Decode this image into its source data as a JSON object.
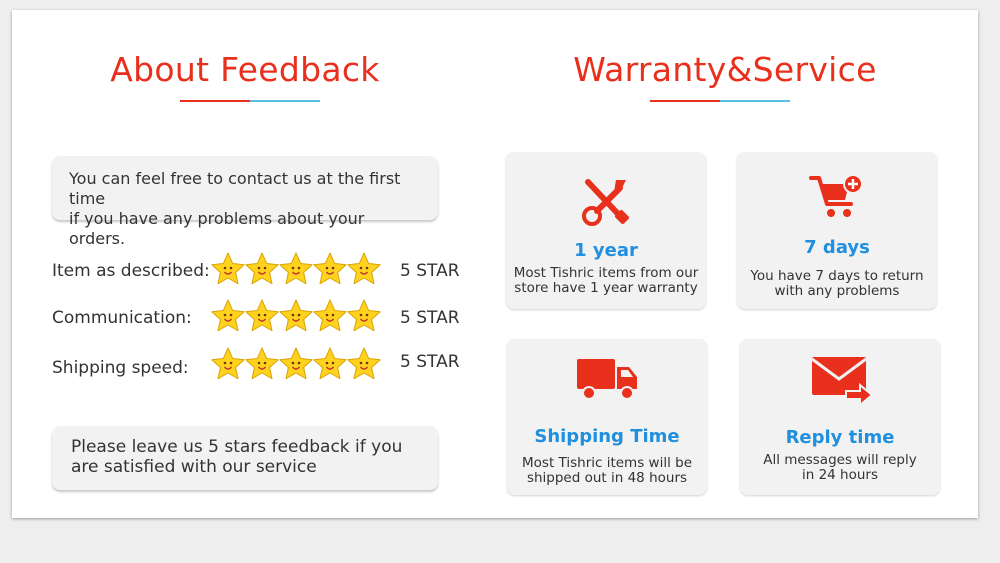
{
  "feedback": {
    "title": "About Feedback",
    "note_top": [
      "You can feel free to contact us at the first time",
      "if you have any problems about your orders."
    ],
    "ratings": [
      {
        "label": "Item as described:",
        "value": "5 STAR",
        "stars": 5
      },
      {
        "label": "Communication:",
        "value": "5 STAR",
        "stars": 5
      },
      {
        "label": "Shipping speed:",
        "value": "5 STAR",
        "stars": 5
      }
    ],
    "note_bottom": [
      "Please leave us 5 stars feedback if you",
      "are satisfied with our service"
    ]
  },
  "warranty": {
    "title": "Warranty&Service",
    "cards": [
      {
        "icon": "tools-icon",
        "title": "1 year",
        "desc": [
          "Most Tishric items from our",
          "store have 1 year warranty"
        ]
      },
      {
        "icon": "cart-icon",
        "title": "7 days",
        "desc": [
          "You have 7 days to return",
          "with any problems"
        ]
      },
      {
        "icon": "truck-icon",
        "title": "Shipping Time",
        "desc": [
          "Most Tishric items will be",
          "shipped out in 48 hours"
        ]
      },
      {
        "icon": "mail-icon",
        "title": "Reply time",
        "desc": [
          "All messages will reply",
          "in 24 hours"
        ]
      }
    ]
  },
  "colors": {
    "heading_red": "#e8301c",
    "accent_blue": "#5bc0de",
    "card_title_blue": "#1f8fde",
    "star_yellow": "#ffd21f"
  }
}
